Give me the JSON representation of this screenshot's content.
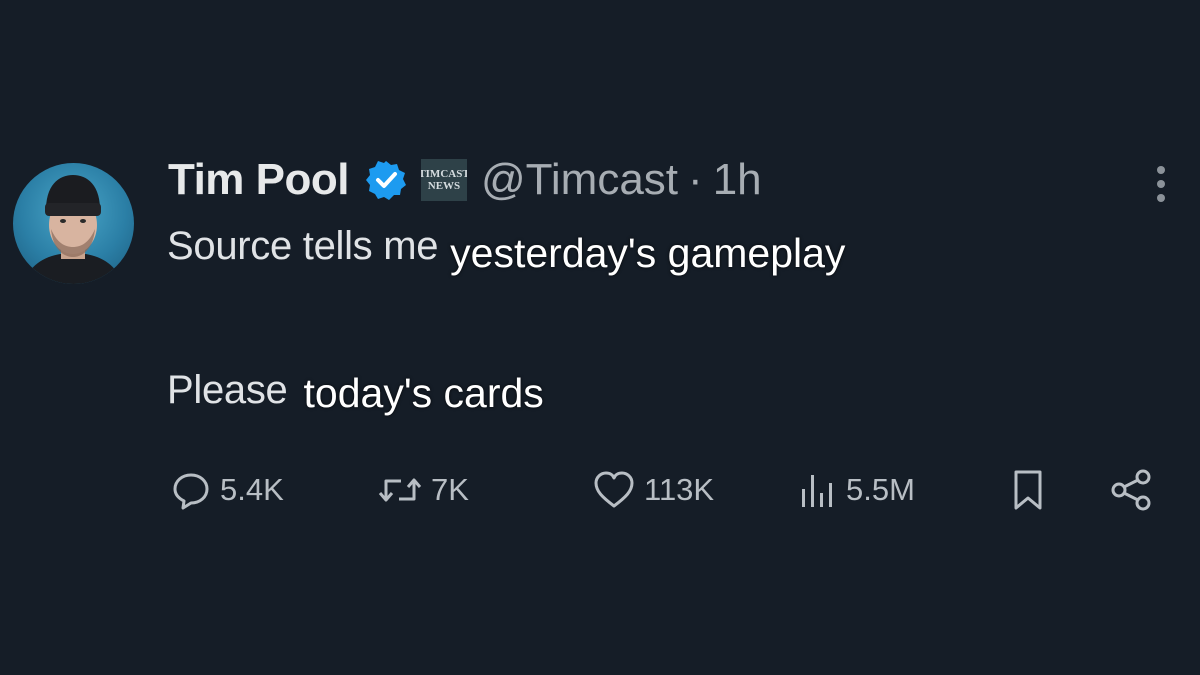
{
  "tweet": {
    "author": {
      "display_name": "Tim Pool",
      "handle": "@Timcast",
      "verified": true,
      "affiliate_badge": [
        "TIMCAST",
        "NEWS"
      ],
      "avatar": "avatar"
    },
    "separator": "·",
    "time": "1h",
    "body": {
      "line1_original": "Source tells me",
      "line1_overlay": "yesterday's gameplay",
      "line2_original": "Please",
      "line2_overlay": "today's cards"
    },
    "actions": {
      "replies": "5.4K",
      "reposts": "7K",
      "likes": "113K",
      "views": "5.5M"
    },
    "icons": {
      "more": "more-vertical-icon",
      "reply": "reply-icon",
      "repost": "repost-icon",
      "like": "heart-icon",
      "views": "views-chart-icon",
      "bookmark": "bookmark-icon",
      "share": "share-icon",
      "verified": "verified-badge-icon"
    },
    "colors": {
      "background": "#151d27",
      "verified_blue": "#1d9bf0",
      "muted_text": "#a7adb3",
      "primary_text": "#e7e9ea"
    }
  }
}
